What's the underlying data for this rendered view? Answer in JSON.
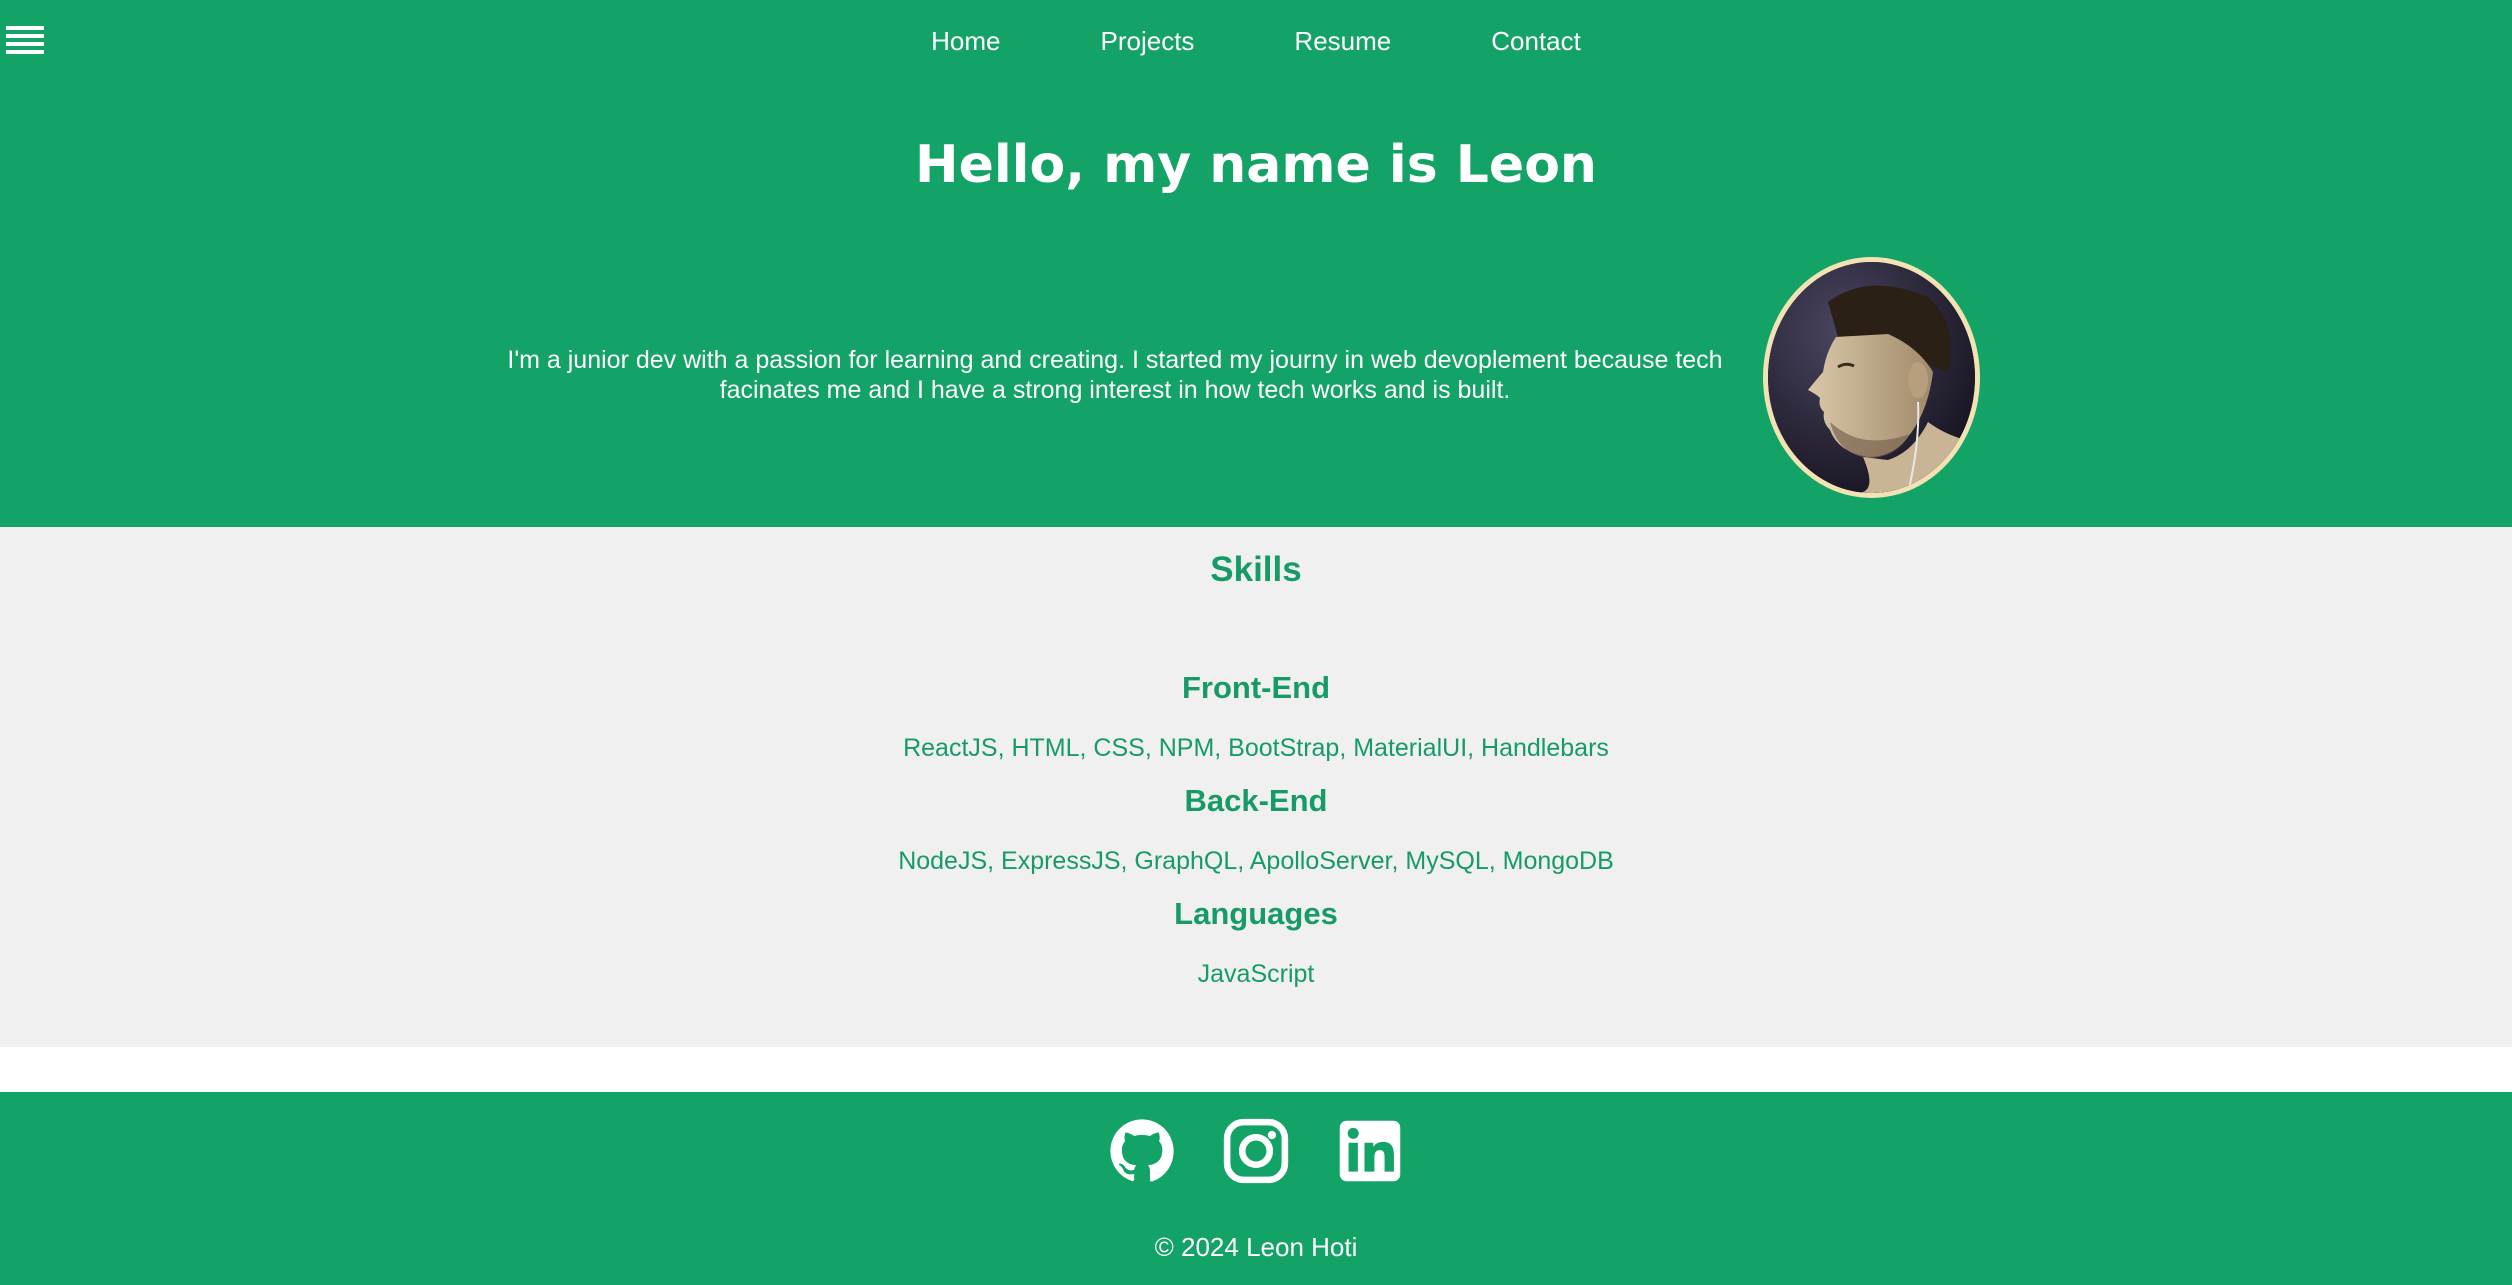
{
  "nav": {
    "menu_icon": "hamburger-icon",
    "links": [
      "Home",
      "Projects",
      "Resume",
      "Contact"
    ]
  },
  "hero": {
    "title": "Hello, my name is Leon",
    "intro": "I'm a junior dev with a passion for learning and creating. I started my journy in web devoplement because tech facinates me and I have a strong interest in how tech works and is built.",
    "avatar": "profile-photo"
  },
  "skills": {
    "title": "Skills",
    "groups": [
      {
        "title": "Front-End",
        "items": "ReactJS, HTML, CSS, NPM, BootStrap, MaterialUI, Handlebars"
      },
      {
        "title": "Back-End",
        "items": "NodeJS, ExpressJS, GraphQL, ApolloServer, MySQL, MongoDB"
      },
      {
        "title": "Languages",
        "items": "JavaScript"
      }
    ]
  },
  "footer": {
    "icons": [
      "github-icon",
      "instagram-icon",
      "linkedin-icon"
    ],
    "copyright": "© 2024 Leon Hoti"
  },
  "colors": {
    "primary": "#13a367",
    "skills_bg": "#f0f0f0",
    "skills_text": "#179b66",
    "avatar_border": "#f3e3b4"
  }
}
